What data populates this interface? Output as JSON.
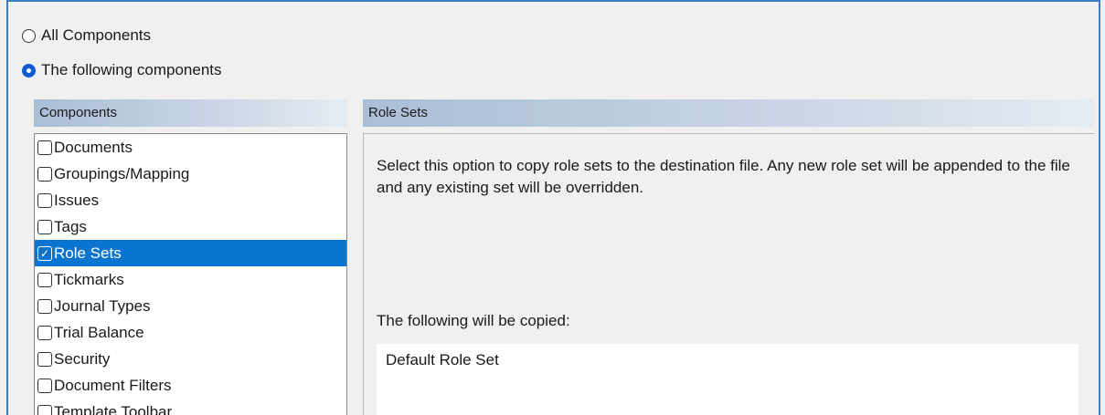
{
  "options": {
    "all_label": "All Components",
    "following_label": "The following components",
    "selected": "following"
  },
  "components_panel": {
    "header": "Components",
    "items": [
      {
        "label": "Documents",
        "checked": false,
        "selected": false
      },
      {
        "label": "Groupings/Mapping",
        "checked": false,
        "selected": false
      },
      {
        "label": "Issues",
        "checked": false,
        "selected": false
      },
      {
        "label": "Tags",
        "checked": false,
        "selected": false
      },
      {
        "label": "Role Sets",
        "checked": true,
        "selected": true
      },
      {
        "label": "Tickmarks",
        "checked": false,
        "selected": false
      },
      {
        "label": "Journal Types",
        "checked": false,
        "selected": false
      },
      {
        "label": "Trial Balance",
        "checked": false,
        "selected": false
      },
      {
        "label": "Security",
        "checked": false,
        "selected": false
      },
      {
        "label": "Document Filters",
        "checked": false,
        "selected": false
      },
      {
        "label": "Template Toolbar",
        "checked": false,
        "selected": false
      }
    ]
  },
  "detail_panel": {
    "header": "Role Sets",
    "description": "Select this option to copy role sets to the destination file.  Any new role set will be appended to the file and any existing set will be overridden.",
    "copied_label": "The following will be copied:",
    "copied_items": [
      "Default Role Set"
    ]
  },
  "colors": {
    "accent": "#0a74d1",
    "radio_selected": "#0f5bd0",
    "frame_border": "#3c7fc0"
  }
}
